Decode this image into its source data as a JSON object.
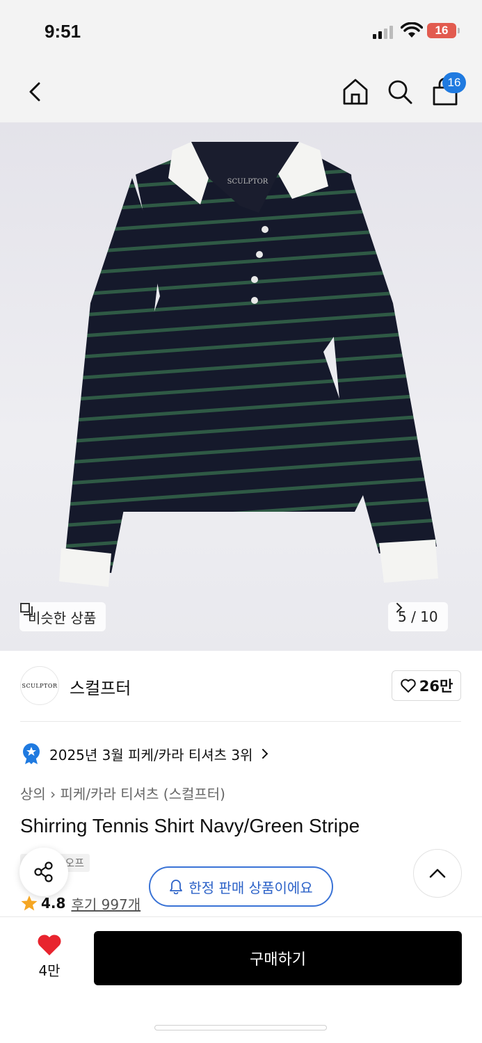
{
  "status_bar": {
    "time": "9:51",
    "battery": "16",
    "battery_color": "#e25b4f"
  },
  "nav": {
    "icons": [
      "back-icon",
      "home-icon",
      "search-icon",
      "cart-icon"
    ],
    "cart_count": "16",
    "badge_color": "#1f7ae0"
  },
  "hero": {
    "similar_label": "비슷한 상품",
    "pager": "5 / 10",
    "image_brand_print": "SCULPTOR"
  },
  "brand": {
    "logo_text": "SCULPTOR",
    "name": "스컬프터",
    "likes": "26만"
  },
  "rank": {
    "text": "2025년 3월 피케/카라 티셔츠 3위"
  },
  "product": {
    "breadcrumb": "상의 › 피케/카라 티셔츠 (스컬프터)",
    "title": "Shirring Tennis Shirt Navy/Green Stripe",
    "tag": "오프",
    "limited_label": "한정 판매 상품이에요",
    "rating": "4.8",
    "reviews": "후기 997개"
  },
  "bottom": {
    "fav_count": "4만",
    "buy_label": "구매하기",
    "buy_color": "#000000",
    "heart_color": "#e8242e"
  }
}
